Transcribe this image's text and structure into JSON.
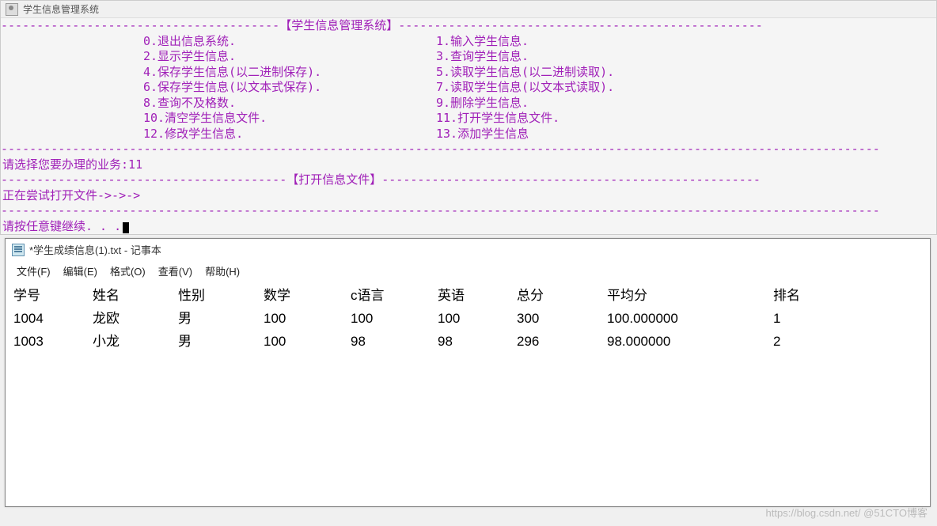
{
  "console": {
    "title": "学生信息管理系统",
    "header_title": "【学生信息管理系统】",
    "menu": [
      {
        "left": "0.退出信息系统.",
        "right": "1.输入学生信息."
      },
      {
        "left": "2.显示学生信息.",
        "right": "3.查询学生信息."
      },
      {
        "left": "4.保存学生信息(以二进制保存).",
        "right": "5.读取学生信息(以二进制读取)."
      },
      {
        "left": "6.保存学生信息(以文本式保存).",
        "right": "7.读取学生信息(以文本式读取)."
      },
      {
        "left": "8.查询不及格数.",
        "right": "9.删除学生信息."
      },
      {
        "left": "10.清空学生信息文件.",
        "right": "11.打开学生信息文件."
      },
      {
        "left": "12.修改学生信息.",
        "right": "13.添加学生信息"
      }
    ],
    "prompt_select": "请选择您要办理的业务:11",
    "section_title": "【打开信息文件】",
    "opening_msg": "正在尝试打开文件->->->",
    "press_any_key": "请按任意键继续. . ."
  },
  "notepad": {
    "title": "*学生成绩信息(1).txt - 记事本",
    "menus": {
      "file": "文件(F)",
      "edit": "编辑(E)",
      "format": "格式(O)",
      "view": "查看(V)",
      "help": "帮助(H)"
    },
    "headers": {
      "id": "学号",
      "name": "姓名",
      "gender": "性别",
      "math": "数学",
      "c": "c语言",
      "eng": "英语",
      "total": "总分",
      "avg": "平均分",
      "rank": "排名"
    },
    "rows": [
      {
        "id": "1004",
        "name": "龙欧",
        "gender": "男",
        "math": "100",
        "c": "100",
        "eng": "100",
        "total": "300",
        "avg": "100.000000",
        "rank": "1"
      },
      {
        "id": "1003",
        "name": "小龙",
        "gender": "男",
        "math": "100",
        "c": "98",
        "eng": "98",
        "total": "296",
        "avg": "98.000000",
        "rank": "2"
      }
    ]
  },
  "watermark": "https://blog.csdn.net/ @51CTO博客"
}
